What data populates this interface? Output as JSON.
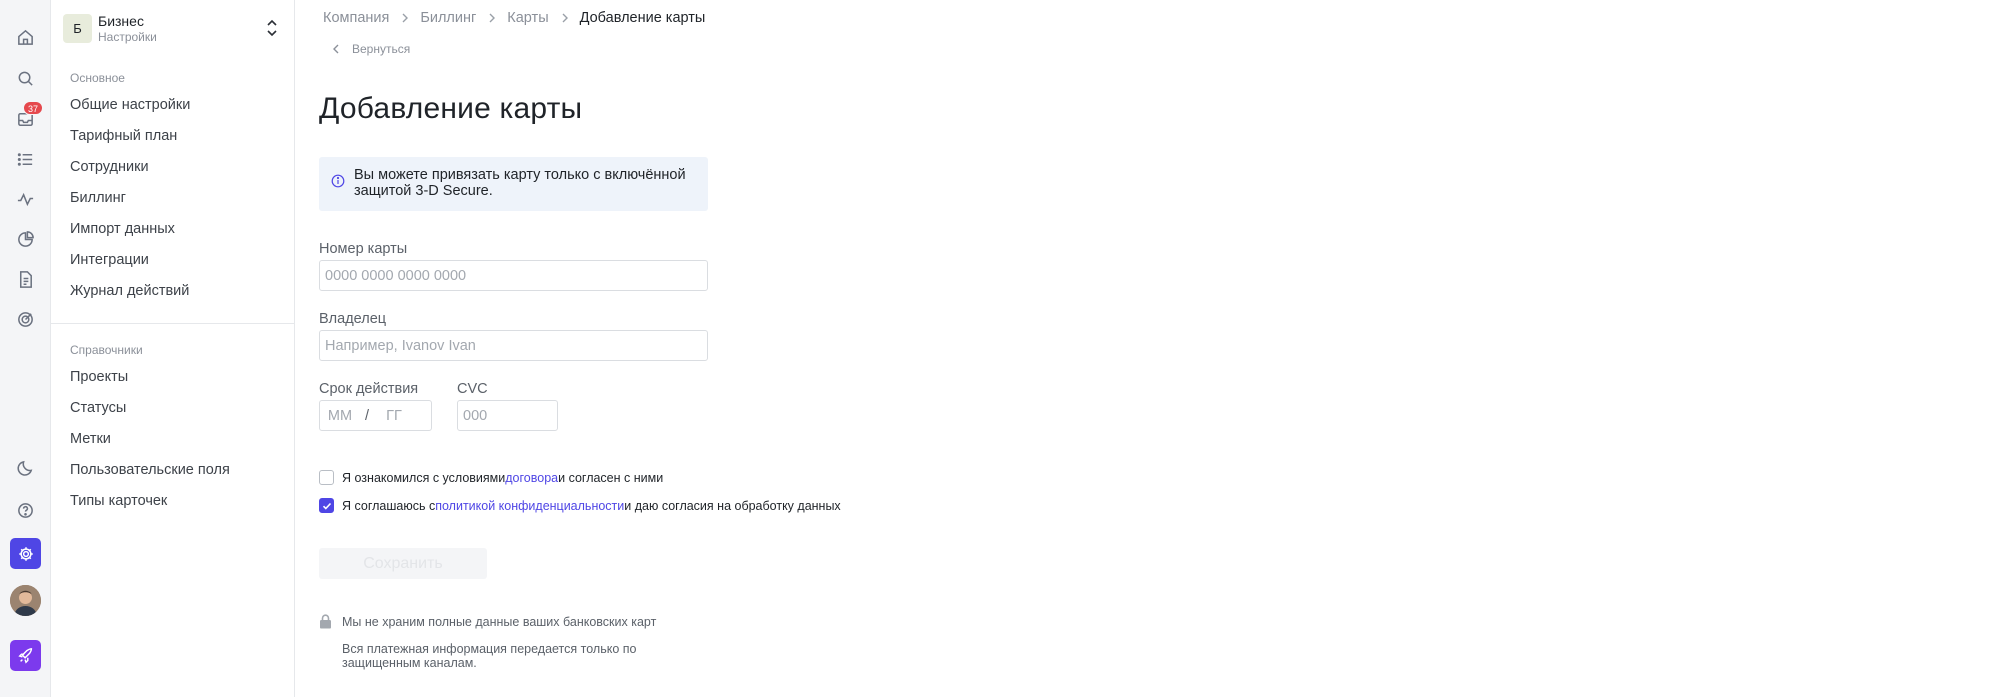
{
  "rail": {
    "inbox_badge": "37",
    "icons": [
      "home-icon",
      "search-icon",
      "inbox-icon",
      "list-icon",
      "activity-icon",
      "pie-chart-icon",
      "document-icon",
      "target-icon",
      "moon-icon",
      "help-icon",
      "settings-icon",
      "avatar",
      "rocket-icon"
    ],
    "accent_settings": "#4f46e5",
    "accent_rocket": "#7c3aed"
  },
  "workspace": {
    "initial": "Б",
    "name": "Бизнес",
    "subtitle": "Настройки"
  },
  "sidebar": {
    "group_main": "Основное",
    "main_items": [
      {
        "label": "Общие настройки"
      },
      {
        "label": "Тарифный план"
      },
      {
        "label": "Сотрудники"
      },
      {
        "label": "Биллинг"
      },
      {
        "label": "Импорт данных"
      },
      {
        "label": "Интеграции"
      },
      {
        "label": "Журнал действий"
      }
    ],
    "group_refs": "Справочники",
    "ref_items": [
      {
        "label": "Проекты"
      },
      {
        "label": "Статусы"
      },
      {
        "label": "Метки"
      },
      {
        "label": "Пользовательские поля"
      },
      {
        "label": "Типы карточек"
      }
    ]
  },
  "breadcrumb": {
    "items": [
      "Компания",
      "Биллинг",
      "Карты"
    ],
    "current": "Добавление карты"
  },
  "back_label": "Вернуться",
  "page_title": "Добавление карты",
  "info": {
    "text": "Вы можете привязать карту только с включённой защитой 3-D Secure."
  },
  "form": {
    "card_number": {
      "label": "Номер карты",
      "placeholder": "0000 0000 0000 0000",
      "value": ""
    },
    "owner": {
      "label": "Владелец",
      "placeholder": "Например, Ivanov Ivan",
      "value": ""
    },
    "expiry": {
      "label": "Срок действия",
      "month_placeholder": "ММ",
      "separator": "/",
      "year_placeholder": "ГГ"
    },
    "cvc": {
      "label": "CVC",
      "placeholder": "000",
      "value": ""
    }
  },
  "consents": {
    "terms": {
      "checked": false,
      "before": "Я ознакомился с условиями ",
      "link": "договора",
      "after": " и согласен с ними"
    },
    "privacy": {
      "checked": true,
      "before": "Я соглашаюсь с ",
      "link": "политикой конфиденциальности",
      "after": " и даю согласия на обработку данных"
    }
  },
  "save_label": "Сохранить",
  "security": {
    "title": "Мы не храним полные данные ваших банковских карт",
    "text": "Вся платежная информация передается только по защищенным каналам."
  }
}
